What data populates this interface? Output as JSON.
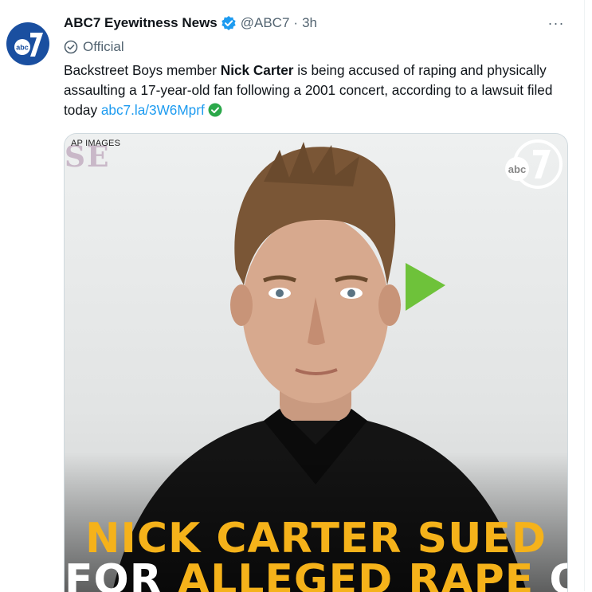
{
  "tweet": {
    "author_name": "ABC7 Eyewitness News",
    "handle": "@ABC7",
    "separator": "·",
    "time": "3h",
    "official_label": "Official",
    "more_label": "···",
    "text_before": "Backstreet Boys member ",
    "text_bold": "Nick Carter",
    "text_after": " is being accused of raping and physically assaulting a 17-year-old fan following a 2001 concert, according to a lawsuit filed today ",
    "link_text": "abc7.la/3W6Mprf"
  },
  "media": {
    "credit": "AP IMAGES",
    "background_letters": "SE",
    "logo_text": "abc",
    "logo_number": "7",
    "headline_line1": "NICK CARTER SUED",
    "headline_line2_a": "FOR ",
    "headline_line2_b": "ALLEGED RAPE",
    "headline_line2_c": " OF"
  },
  "colors": {
    "link": "#1d9bf0",
    "verified": "#1d9bf0",
    "headline_yellow": "#f5b21a",
    "muted": "#536471"
  },
  "icons": {
    "avatar": "abc7-logo-icon",
    "verified": "verified-badge-icon",
    "official": "official-check-icon",
    "more": "more-options-icon",
    "link_badge": "check-circle-icon"
  }
}
